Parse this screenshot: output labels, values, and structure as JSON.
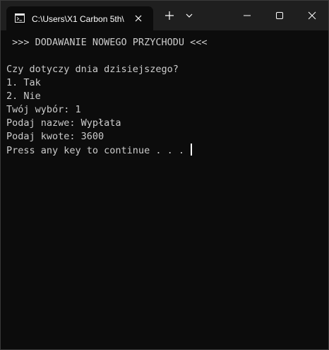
{
  "tab": {
    "title": "C:\\Users\\X1 Carbon 5th\\",
    "icon": "terminal-icon"
  },
  "toolbar": {
    "new_tab_icon": "plus-icon",
    "dropdown_icon": "chevron-down-icon"
  },
  "window_controls": {
    "minimize_icon": "minimize-icon",
    "maximize_icon": "maximize-icon",
    "close_icon": "close-icon"
  },
  "console": {
    "header": " >>> DODAWANIE NOWEGO PRZYCHODU <<<",
    "question": "Czy dotyczy dnia dzisiejszego?",
    "option_1": "1. Tak",
    "option_2": "2. Nie",
    "choice": "Twój wybór: 1",
    "name": "Podaj nazwe: Wypłata",
    "amount": "Podaj kwote: 3600",
    "prompt": "Press any key to continue . . . "
  },
  "colors": {
    "background": "#0c0c0c",
    "titlebar": "#1f1f1f",
    "text": "#cccccc"
  }
}
